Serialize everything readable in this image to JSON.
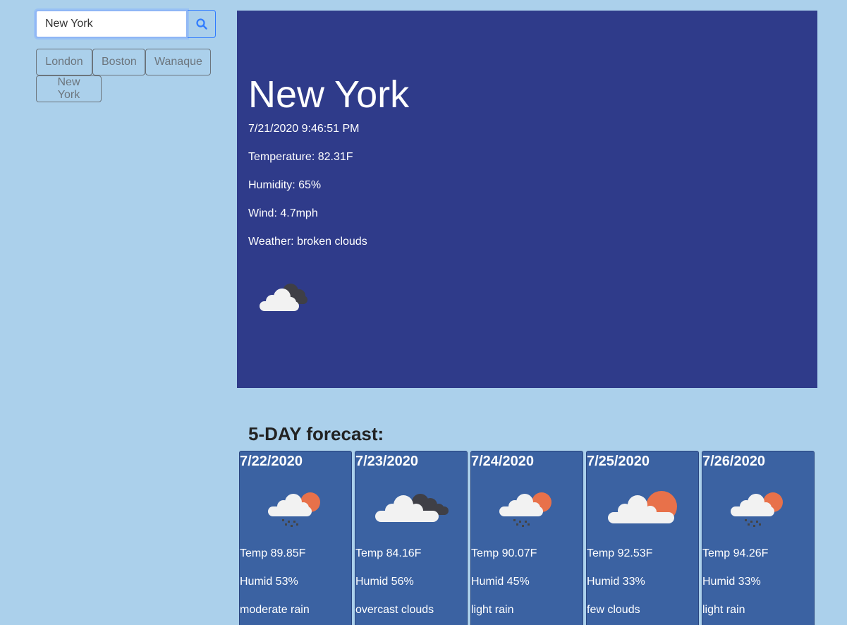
{
  "search": {
    "value": "New York",
    "button_icon": "search-icon"
  },
  "history": [
    "London",
    "Boston",
    "Wanaque",
    "New York"
  ],
  "current": {
    "city": "New York",
    "datetime": "7/21/2020 9:46:51 PM",
    "temperature": "Temperature: 82.31F",
    "humidity": "Humidity: 65%",
    "wind": "Wind: 4.7mph",
    "weather": "Weather: broken clouds",
    "icon": "broken-clouds-icon",
    "panel_color": "#2f3b8a"
  },
  "forecast": {
    "heading": "5-DAY forecast:",
    "days": [
      {
        "date": "7/22/2020",
        "temp": "Temp 89.85F",
        "humid": "Humid 53%",
        "desc": "moderate rain",
        "icon": "rain-sun-icon"
      },
      {
        "date": "7/23/2020",
        "temp": "Temp 84.16F",
        "humid": "Humid 56%",
        "desc": "overcast clouds",
        "icon": "overcast-clouds-icon"
      },
      {
        "date": "7/24/2020",
        "temp": "Temp 90.07F",
        "humid": "Humid 45%",
        "desc": "light rain",
        "icon": "rain-sun-icon"
      },
      {
        "date": "7/25/2020",
        "temp": "Temp 92.53F",
        "humid": "Humid 33%",
        "desc": "few clouds",
        "icon": "few-clouds-icon"
      },
      {
        "date": "7/26/2020",
        "temp": "Temp 94.26F",
        "humid": "Humid 33%",
        "desc": "light rain",
        "icon": "rain-sun-icon"
      }
    ]
  },
  "colors": {
    "background": "#abd0eb",
    "card": "#3b62a2",
    "sun": "#e8714a"
  }
}
